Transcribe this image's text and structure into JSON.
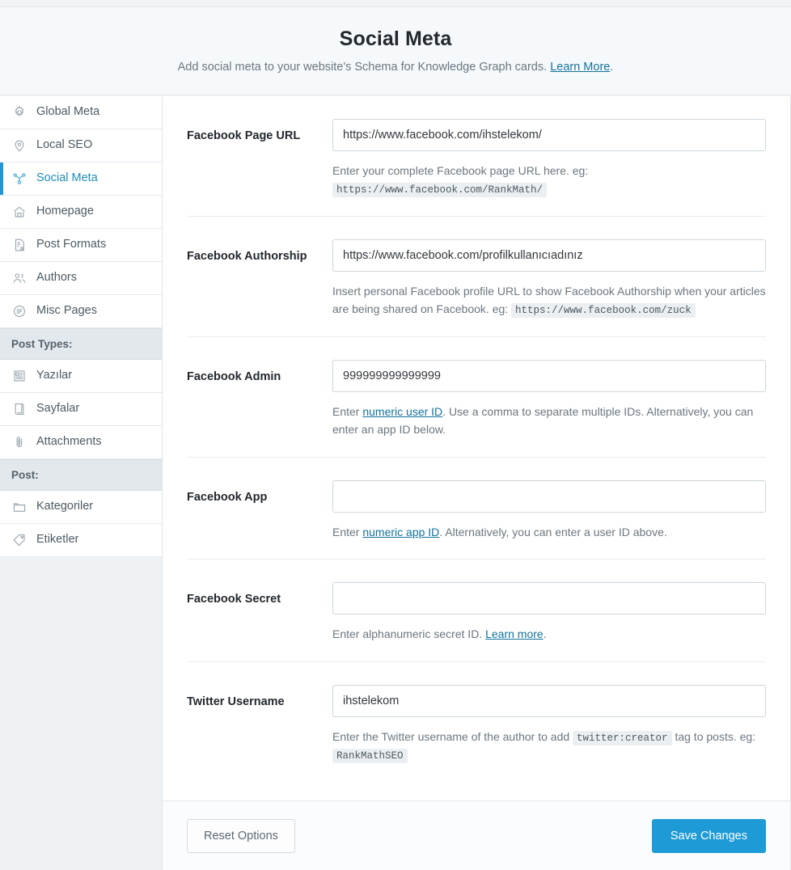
{
  "header": {
    "title": "Social Meta",
    "subtitle_before": "Add social meta to your website's Schema for Knowledge Graph cards.",
    "learn_more_label": "Learn More",
    "subtitle_after": "."
  },
  "sidebar": {
    "items": [
      {
        "label": "Global Meta",
        "icon": "gear-icon",
        "active": false,
        "type": "item"
      },
      {
        "label": "Local SEO",
        "icon": "map-pin-icon",
        "active": false,
        "type": "item"
      },
      {
        "label": "Social Meta",
        "icon": "share-nodes-icon",
        "active": true,
        "type": "item"
      },
      {
        "label": "Homepage",
        "icon": "home-icon",
        "active": false,
        "type": "item"
      },
      {
        "label": "Post Formats",
        "icon": "document-icon",
        "active": false,
        "type": "item"
      },
      {
        "label": "Authors",
        "icon": "users-icon",
        "active": false,
        "type": "item"
      },
      {
        "label": "Misc Pages",
        "icon": "list-circle-icon",
        "active": false,
        "type": "item"
      },
      {
        "label": "Post Types:",
        "icon": "",
        "active": false,
        "type": "group"
      },
      {
        "label": "Yazılar",
        "icon": "newspaper-icon",
        "active": false,
        "type": "item"
      },
      {
        "label": "Sayfalar",
        "icon": "page-icon",
        "active": false,
        "type": "item"
      },
      {
        "label": "Attachments",
        "icon": "paperclip-icon",
        "active": false,
        "type": "item"
      },
      {
        "label": "Post:",
        "icon": "",
        "active": false,
        "type": "group"
      },
      {
        "label": "Kategoriler",
        "icon": "folder-icon",
        "active": false,
        "type": "item"
      },
      {
        "label": "Etiketler",
        "icon": "tag-icon",
        "active": false,
        "type": "item"
      }
    ]
  },
  "fields": [
    {
      "label": "Facebook Page URL",
      "value": "https://www.facebook.com/ihstelekom/",
      "placeholder": "",
      "hint_parts": [
        {
          "t": "text",
          "v": "Enter your complete Facebook page URL here. eg: "
        },
        {
          "t": "code",
          "v": "https://www.facebook.com/RankMath/"
        }
      ]
    },
    {
      "label": "Facebook Authorship",
      "value": "https://www.facebook.com/profilkullanıcıadınız",
      "placeholder": "",
      "hint_parts": [
        {
          "t": "text",
          "v": "Insert personal Facebook profile URL to show Facebook Authorship when your articles are being shared on Facebook. eg: "
        },
        {
          "t": "code",
          "v": "https://www.facebook.com/zuck"
        }
      ]
    },
    {
      "label": "Facebook Admin",
      "value": "999999999999999",
      "placeholder": "",
      "hint_parts": [
        {
          "t": "text",
          "v": "Enter "
        },
        {
          "t": "link",
          "v": "numeric user ID"
        },
        {
          "t": "text",
          "v": ". Use a comma to separate multiple IDs. Alternatively, you can enter an app ID below."
        }
      ]
    },
    {
      "label": "Facebook App",
      "value": "",
      "placeholder": "",
      "hint_parts": [
        {
          "t": "text",
          "v": "Enter "
        },
        {
          "t": "link",
          "v": "numeric app ID"
        },
        {
          "t": "text",
          "v": ". Alternatively, you can enter a user ID above."
        }
      ]
    },
    {
      "label": "Facebook Secret",
      "value": "",
      "placeholder": "",
      "hint_parts": [
        {
          "t": "text",
          "v": "Enter alphanumeric secret ID. "
        },
        {
          "t": "link",
          "v": "Learn more"
        },
        {
          "t": "text",
          "v": "."
        }
      ]
    },
    {
      "label": "Twitter Username",
      "value": "ihstelekom",
      "placeholder": "",
      "hint_parts": [
        {
          "t": "text",
          "v": "Enter the Twitter username of the author to add "
        },
        {
          "t": "code",
          "v": "twitter:creator"
        },
        {
          "t": "text",
          "v": " tag to posts. eg: "
        },
        {
          "t": "code",
          "v": "RankMathSEO"
        }
      ]
    }
  ],
  "footer": {
    "reset_label": "Reset Options",
    "save_label": "Save Changes"
  },
  "colors": {
    "accent": "#1e9ad6",
    "link": "#13739d",
    "active_nav": "#1e8cbe",
    "header_bg": "#f6f9fb",
    "sidebar_bg": "#eef2f5"
  }
}
